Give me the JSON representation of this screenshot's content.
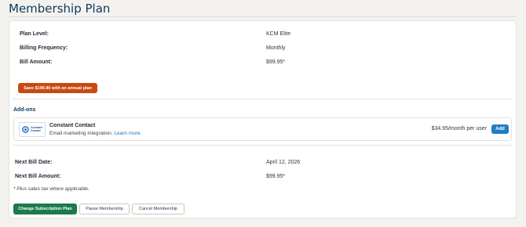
{
  "page": {
    "title": "Membership Plan"
  },
  "plan": {
    "rows": [
      {
        "label": "Plan Level:",
        "value": "KCM Elite"
      },
      {
        "label": "Billing Frequency:",
        "value": "Monthly"
      },
      {
        "label": "Bill Amount:",
        "value": "$99.95*"
      }
    ],
    "annual_button_label": "Save $199.90 with an annual plan"
  },
  "addons": {
    "heading": "Add-ons",
    "items": [
      {
        "logo_text_line1": "Constant",
        "logo_text_line2": "Contact",
        "name": "Constant Contact",
        "description": "Email marketing integration.",
        "learn_more": "Learn more.",
        "price": "$34.95/month per user",
        "add_label": "Add"
      }
    ]
  },
  "billing": {
    "rows": [
      {
        "label": "Next Bill Date:",
        "value": "April 12, 2026"
      },
      {
        "label": "Next Bill Amount:",
        "value": "$99.95*"
      }
    ],
    "tax_note": "* Plus sales tax where applicable."
  },
  "actions": {
    "change_label": "Change Subscription Plan",
    "pause_label": "Pause Membership",
    "cancel_label": "Cancel Membership"
  },
  "colors": {
    "accent_orange": "#c84a11",
    "accent_green": "#1c7a4c",
    "accent_blue": "#1f7fc1",
    "title_navy": "#0f3a5c"
  },
  "icons": {
    "addon_logo": "constant-contact-logo-icon"
  }
}
